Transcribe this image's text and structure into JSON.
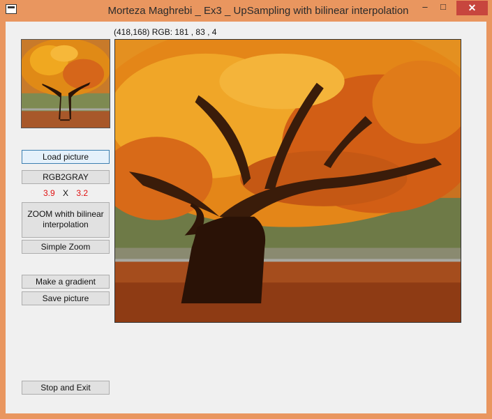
{
  "window": {
    "title": "Morteza Maghrebi _ Ex3 _ UpSampling with bilinear interpolation",
    "minimize_glyph": "–",
    "maximize_glyph": "□",
    "close_glyph": "✕",
    "accent": "#e9965f"
  },
  "status": {
    "coords": "(418,168)  RGB: 181 , 83 , 4"
  },
  "buttons": {
    "load": "Load picture",
    "rgb2gray": "RGB2GRAY",
    "zoom_bilinear": "ZOOM whith bilinear interpolation",
    "simple_zoom": "Simple Zoom",
    "gradient": "Make a gradient",
    "save": "Save picture",
    "stop": "Stop and Exit"
  },
  "zoom": {
    "x_factor": "3.9",
    "separator": "X",
    "y_factor": "3.2",
    "factor_color": "#e01010"
  }
}
